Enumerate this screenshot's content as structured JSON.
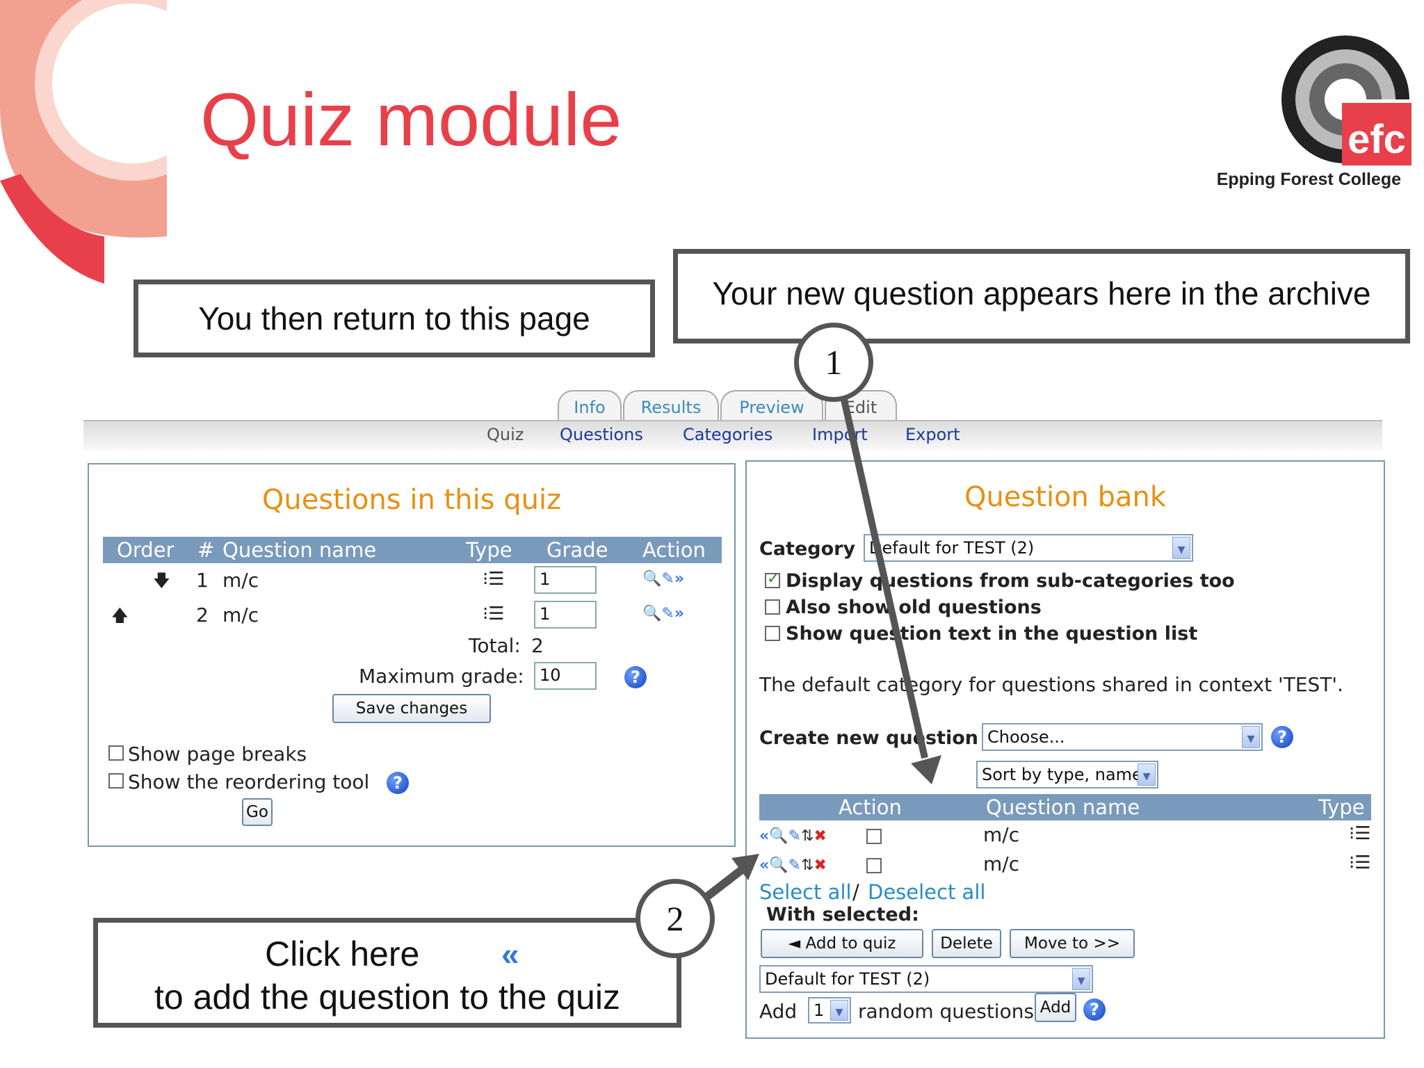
{
  "slide": {
    "title": "Quiz module"
  },
  "logo": {
    "initials": "efc",
    "name": "Epping Forest College"
  },
  "callouts": {
    "return": "You then return to this page",
    "archive": "Your new question appears here in the archive",
    "click_line1": "Click here",
    "click_line2": "to add the  question to the quiz",
    "num1": "1",
    "num2": "2"
  },
  "tabs": [
    "Info",
    "Results",
    "Preview",
    "Edit"
  ],
  "subtabs": [
    "Quiz",
    "Questions",
    "Categories",
    "Import",
    "Export"
  ],
  "quiz_panel": {
    "title": "Questions in this quiz",
    "headers": [
      "Order",
      "#",
      "Question name",
      "Type",
      "Grade",
      "Action"
    ],
    "rows": [
      {
        "num": "1",
        "name": "m/c",
        "grade": "1"
      },
      {
        "num": "2",
        "name": "m/c",
        "grade": "1"
      }
    ],
    "total_label": "Total:",
    "total_value": "2",
    "max_grade_label": "Maximum grade:",
    "max_grade_value": "10",
    "save_button": "Save changes",
    "show_page_breaks": "Show page breaks",
    "show_reorder": "Show the reordering tool",
    "go_button": "Go"
  },
  "bank_panel": {
    "title": "Question bank",
    "category_label": "Category",
    "category_value": "Default for TEST (2)",
    "opt_subcats": "Display questions from sub-categories too",
    "opt_old": "Also show old questions",
    "opt_text": "Show question text in the question list",
    "info_text": "The default category for questions shared in context 'TEST'.",
    "create_label": "Create new question",
    "create_value": "Choose...",
    "sort_value": "Sort by type, name",
    "headers": [
      "Action",
      "Question name",
      "Type"
    ],
    "rows": [
      {
        "name": "m/c"
      },
      {
        "name": "m/c"
      }
    ],
    "select_all": "Select all",
    "separator": "/",
    "deselect_all": "Deselect all",
    "with_selected": "With selected:",
    "add_to_quiz": "◄ Add to quiz",
    "delete": "Delete",
    "move_to": "Move to >>",
    "move_category": "Default for TEST (2)",
    "add_label": "Add",
    "random_count": "1",
    "random_label": "random questions",
    "add_button": "Add"
  },
  "colors": {
    "title_red": "#e8404a",
    "panel_orange": "#e89010",
    "header_blue": "#7a9abc",
    "link_blue": "#2a8acb"
  }
}
